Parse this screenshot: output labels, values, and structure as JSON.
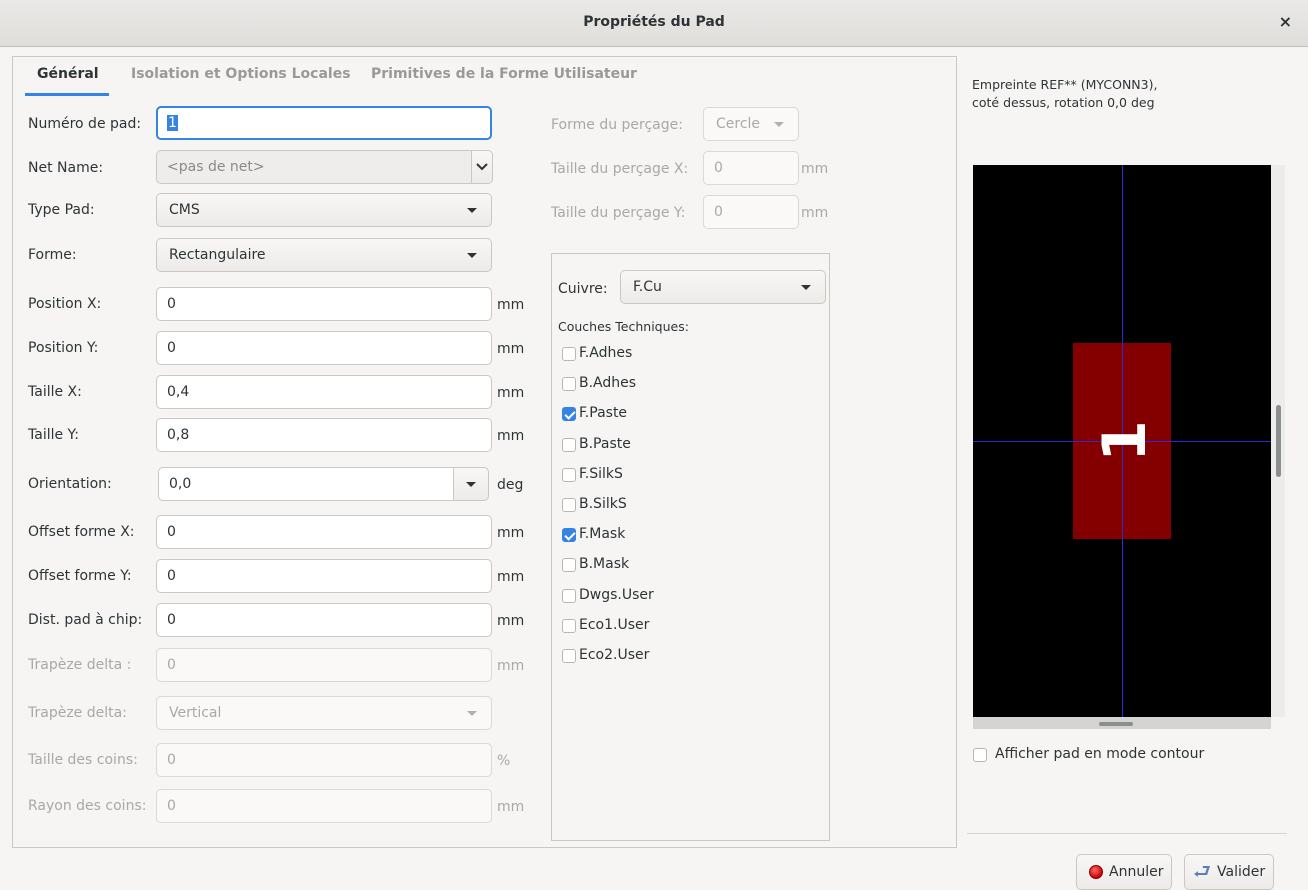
{
  "window": {
    "title": "Propriétés du Pad",
    "close": "×"
  },
  "tabs": [
    "Général",
    "Isolation et Options Locales",
    "Primitives de la Forme Utilisateur"
  ],
  "general": {
    "pad_number": {
      "label": "Numéro de pad:",
      "value": "1"
    },
    "net_name": {
      "label": "Net Name:",
      "value": "<pas de net>"
    },
    "pad_type": {
      "label": "Type Pad:",
      "value": "CMS"
    },
    "shape": {
      "label": "Forme:",
      "value": "Rectangulaire"
    },
    "pos_x": {
      "label": "Position X:",
      "value": "0",
      "unit": "mm"
    },
    "pos_y": {
      "label": "Position Y:",
      "value": "0",
      "unit": "mm"
    },
    "size_x": {
      "label": "Taille X:",
      "value": "0,4",
      "unit": "mm"
    },
    "size_y": {
      "label": "Taille Y:",
      "value": "0,8",
      "unit": "mm"
    },
    "orientation": {
      "label": "Orientation:",
      "value": "0,0",
      "unit": "deg"
    },
    "offset_x": {
      "label": "Offset forme X:",
      "value": "0",
      "unit": "mm"
    },
    "offset_y": {
      "label": "Offset forme Y:",
      "value": "0",
      "unit": "mm"
    },
    "die_length": {
      "label": "Dist. pad à chip:",
      "value": "0",
      "unit": "mm"
    },
    "trap_delta": {
      "label": "Trapèze delta :",
      "value": "0",
      "unit": "mm"
    },
    "trap_axis": {
      "label": "Trapèze delta:",
      "value": "Vertical"
    },
    "corner_size": {
      "label": "Taille des coins:",
      "value": "0",
      "unit": "%"
    },
    "corner_radius": {
      "label": "Rayon des coins:",
      "value": "0",
      "unit": "mm"
    }
  },
  "drill": {
    "shape": {
      "label": "Forme du perçage:",
      "value": "Cercle"
    },
    "size_x": {
      "label": "Taille du perçage X:",
      "value": "0",
      "unit": "mm"
    },
    "size_y": {
      "label": "Taille du perçage Y:",
      "value": "0",
      "unit": "mm"
    }
  },
  "layers": {
    "copper_label": "Cuivre:",
    "copper_value": "F.Cu",
    "tech_label": "Couches Techniques:",
    "items": [
      {
        "name": "F.Adhes",
        "checked": false
      },
      {
        "name": "B.Adhes",
        "checked": false
      },
      {
        "name": "F.Paste",
        "checked": true
      },
      {
        "name": "B.Paste",
        "checked": false
      },
      {
        "name": "F.SilkS",
        "checked": false
      },
      {
        "name": "B.SilkS",
        "checked": false
      },
      {
        "name": "F.Mask",
        "checked": true
      },
      {
        "name": "B.Mask",
        "checked": false
      },
      {
        "name": "Dwgs.User",
        "checked": false
      },
      {
        "name": "Eco1.User",
        "checked": false
      },
      {
        "name": "Eco2.User",
        "checked": false
      }
    ]
  },
  "preview": {
    "info": "Empreinte REF** (MYCONN3),\ncoté dessus, rotation 0,0 deg",
    "pad_number": "1",
    "outline_label": "Afficher pad en mode contour",
    "outline_checked": false,
    "pad_color": "#840000",
    "crosshair_color": "#2a2ad8"
  },
  "buttons": {
    "cancel": "Annuler",
    "ok": "Valider"
  },
  "colors": {
    "accent": "#3584e4",
    "window_bg": "#f6f5f4"
  }
}
